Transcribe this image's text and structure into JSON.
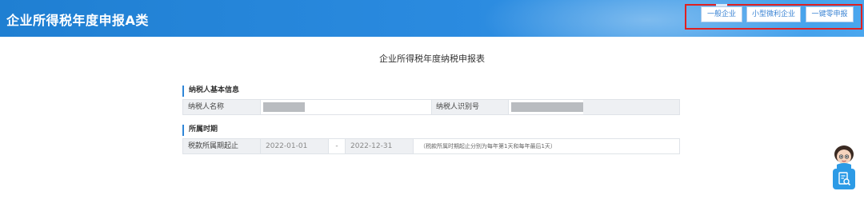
{
  "header": {
    "title": "企业所得税年度申报A类",
    "buttons": [
      {
        "label": "一般企业"
      },
      {
        "label": "小型微利企业"
      },
      {
        "label": "一键零申报"
      }
    ]
  },
  "form_title": "企业所得税年度纳税申报表",
  "basic_info": {
    "section_label": "纳税人基本信息",
    "name_label": "纳税人名称",
    "id_label": "纳税人识别号"
  },
  "period": {
    "section_label": "所属时期",
    "label": "税款所属期起止",
    "start": "2022-01-01",
    "separator": "-",
    "end": "2022-12-31",
    "hint": "（税款所属时期起止分别为每年第1天和每年最后1天）"
  },
  "colors": {
    "header_blue": "#2b8be0",
    "highlight_red": "#e02020",
    "accent_blue": "#2f86d8"
  }
}
